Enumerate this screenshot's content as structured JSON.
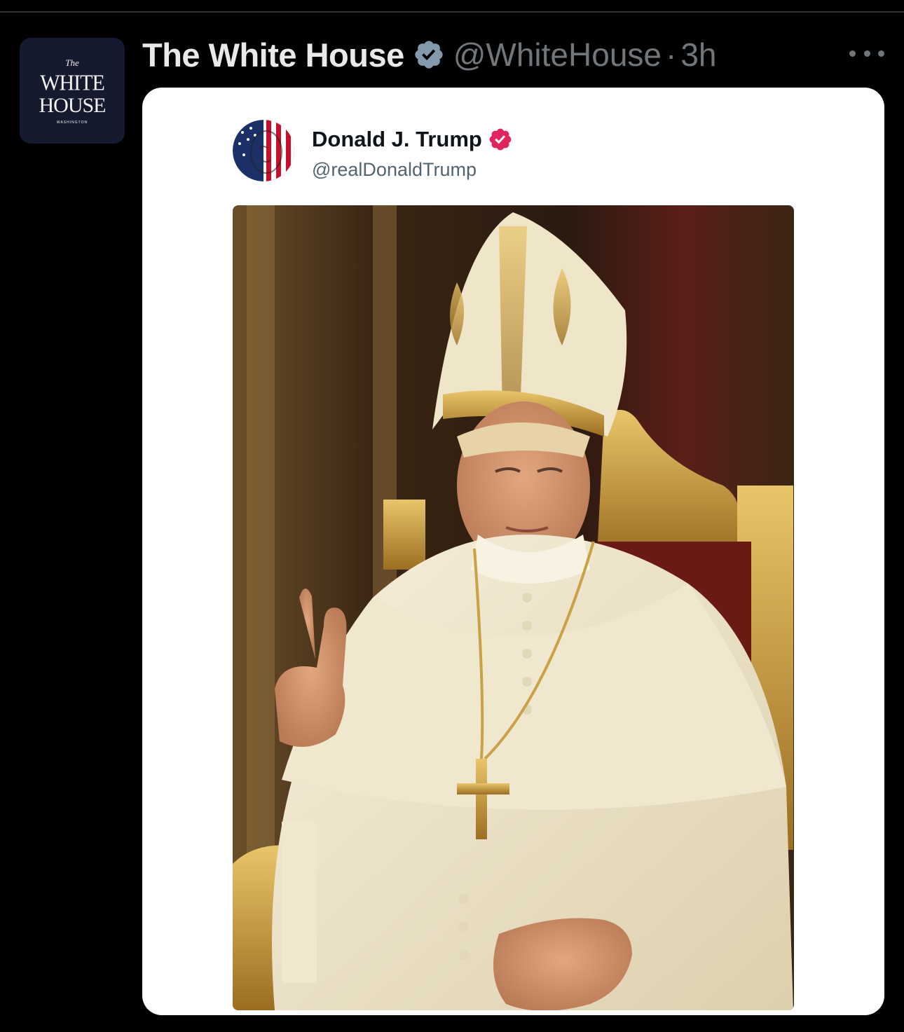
{
  "tweet": {
    "avatar": {
      "line_the": "The",
      "line_white": "WHITE",
      "line_house": "HOUSE",
      "line_washington": "WASHINGTON"
    },
    "display_name": "The White House",
    "handle": "@WhiteHouse",
    "separator": "·",
    "time": "3h",
    "verified_icon": "verified-badge-icon",
    "more_icon": "more-options-icon"
  },
  "embedded_post": {
    "display_name": "Donald J. Trump",
    "handle": "@realDonaldTrump",
    "verified_icon": "verified-badge-icon",
    "image_description": "papal-portrait-image"
  },
  "colors": {
    "background": "#000000",
    "name_text": "#e7e9ea",
    "secondary_text": "#71767b",
    "verified_gray": "#829aab",
    "verified_pink": "#e0245e",
    "card_bg": "#ffffff"
  }
}
